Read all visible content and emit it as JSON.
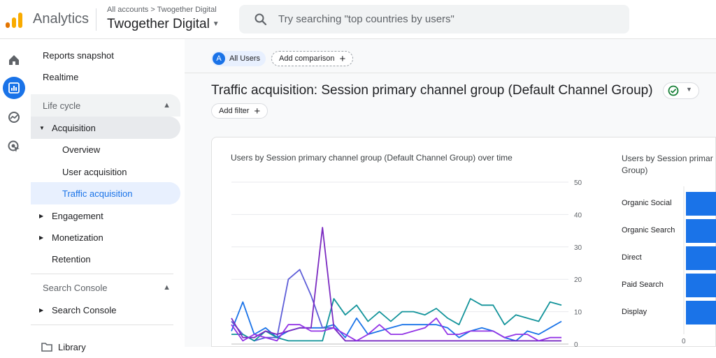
{
  "app": {
    "title": "Analytics",
    "breadcrumb": "All accounts > Twogether Digital",
    "account": "Twogether Digital"
  },
  "search": {
    "placeholder": "Try searching \"top countries by users\""
  },
  "rail": [
    {
      "name": "home-icon"
    },
    {
      "name": "reports-icon"
    },
    {
      "name": "explore-icon"
    },
    {
      "name": "advertising-icon"
    }
  ],
  "nav": {
    "reports_snapshot": "Reports snapshot",
    "realtime": "Realtime",
    "life_cycle": "Life cycle",
    "acquisition": "Acquisition",
    "overview": "Overview",
    "user_acquisition": "User acquisition",
    "traffic_acquisition": "Traffic acquisition",
    "engagement": "Engagement",
    "monetization": "Monetization",
    "retention": "Retention",
    "search_console_group": "Search Console",
    "search_console": "Search Console",
    "library": "Library"
  },
  "toolbar": {
    "all_users": "All Users",
    "all_users_initial": "A",
    "add_comparison": "Add comparison",
    "add_filter": "Add filter"
  },
  "report": {
    "title": "Traffic acquisition: Session primary channel group (Default Channel Group)"
  },
  "colors": {
    "accent": "#1a73e8",
    "success": "#188038"
  },
  "chart_data": [
    {
      "type": "line",
      "title": "Users by Session primary channel group (Default Channel Group) over time",
      "y_ticks": [
        0,
        10,
        20,
        30,
        40,
        50
      ],
      "ylim": [
        0,
        50
      ],
      "grid": true,
      "x": [
        1,
        2,
        3,
        4,
        5,
        6,
        7,
        8,
        9,
        10,
        11,
        12,
        13,
        14,
        15,
        16,
        17,
        18,
        19,
        20,
        21,
        22,
        23,
        24,
        25,
        26,
        27,
        28,
        29,
        30
      ],
      "series": [
        {
          "color": "#1a73e8",
          "values": [
            4,
            13,
            3,
            5,
            2,
            4,
            5,
            5,
            5,
            6,
            2,
            8,
            3,
            4,
            5,
            6,
            6,
            6,
            6,
            5,
            2,
            4,
            5,
            4,
            2,
            1,
            4,
            3,
            5,
            7
          ]
        },
        {
          "color": "#5e5ed8",
          "values": [
            7,
            3,
            1,
            2,
            2,
            20,
            23,
            15,
            5,
            5,
            1,
            1,
            1,
            1,
            1,
            1,
            1,
            1,
            1,
            1,
            1,
            1,
            1,
            1,
            1,
            1,
            1,
            1,
            1,
            1
          ]
        },
        {
          "color": "#12939a",
          "values": [
            3,
            3,
            1,
            4,
            2,
            1,
            1,
            1,
            1,
            14,
            9,
            12,
            7,
            10,
            7,
            10,
            10,
            9,
            11,
            8,
            6,
            14,
            12,
            12,
            6,
            9,
            8,
            7,
            13,
            12
          ]
        },
        {
          "color": "#7b2bc1",
          "values": [
            8,
            2,
            2,
            4,
            3,
            4,
            5,
            5,
            36,
            5,
            1,
            1,
            1,
            1,
            1,
            1,
            1,
            1,
            1,
            1,
            1,
            1,
            1,
            1,
            1,
            1,
            1,
            1,
            1,
            1
          ]
        },
        {
          "color": "#9334e6",
          "values": [
            6,
            1,
            3,
            2,
            1,
            6,
            6,
            4,
            4,
            5,
            3,
            1,
            3,
            6,
            3,
            3,
            4,
            5,
            8,
            3,
            3,
            4,
            4,
            4,
            2,
            3,
            3,
            1,
            2,
            2
          ]
        }
      ]
    },
    {
      "type": "bar",
      "title": "Users by Session primary channel group (Default Channel Group)",
      "visible_title": "Users by Session primar Group)",
      "categories": [
        "Organic Social",
        "Organic Search",
        "Direct",
        "Paid Search",
        "Display"
      ],
      "x_ticks": [
        0
      ],
      "color": "#1a73e8"
    }
  ]
}
